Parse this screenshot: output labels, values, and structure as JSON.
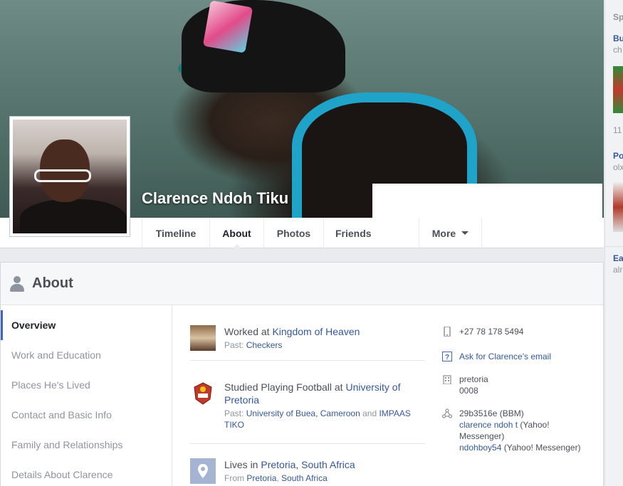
{
  "cover": {
    "name": "Clarence Ndoh Tiku"
  },
  "nav": {
    "tabs": [
      {
        "label": "Timeline"
      },
      {
        "label": "About"
      },
      {
        "label": "Photos"
      },
      {
        "label": "Friends"
      },
      {
        "label": "More"
      }
    ]
  },
  "about": {
    "title": "About",
    "menu": [
      {
        "label": "Overview"
      },
      {
        "label": "Work and Education"
      },
      {
        "label": "Places He's Lived"
      },
      {
        "label": "Contact and Basic Info"
      },
      {
        "label": "Family and Relationships"
      },
      {
        "label": "Details About Clarence"
      }
    ],
    "work": {
      "prefix": "Worked at ",
      "employer": "Kingdom of Heaven",
      "past_label": "Past: ",
      "past_employer": "Checkers"
    },
    "education": {
      "prefix": "Studied Playing Football at ",
      "school": "University of Pretoria",
      "past_label": "Past: ",
      "past_school_1": "University of Buea, Cameroon",
      "and_text": " and ",
      "past_school_2": "IMPAAS TIKO"
    },
    "lives": {
      "prefix": "Lives in ",
      "city": "Pretoria",
      "sep": ", ",
      "country": "South Africa",
      "from_label": "From ",
      "from_city": "Pretoria",
      "from_sep": ", ",
      "from_country": "South Africa"
    },
    "contact": {
      "phone": "+27 78 178 5494",
      "ask_email": "Ask for Clarence's email",
      "city": "pretoria",
      "postcode": "0008",
      "bbm": "29b3516e",
      "bbm_label": " (BBM)",
      "yahoo1": "clarence ndoh t",
      "yahoo1_label": " (Yahoo! Messenger)",
      "yahoo2": "ndohboy54",
      "yahoo2_label": " (Yahoo! Messenger)"
    }
  },
  "rail": {
    "items": [
      "Sp",
      "Bu",
      "ch",
      "11",
      "Po",
      "olx",
      "Ea",
      "alr"
    ]
  }
}
